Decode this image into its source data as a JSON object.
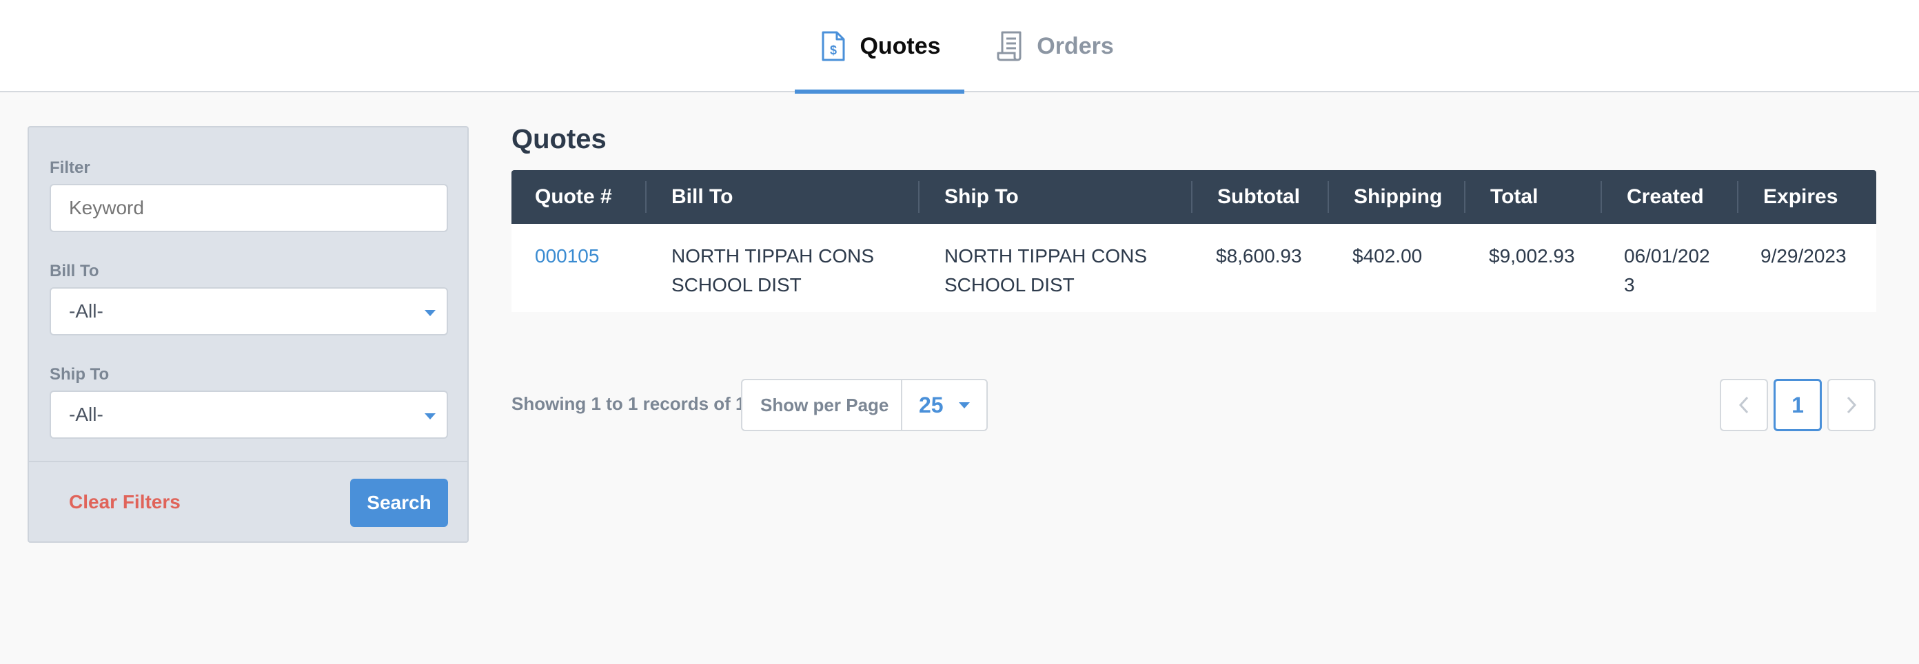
{
  "nav": {
    "tabs": [
      {
        "label": "Quotes",
        "icon": "document-dollar-icon",
        "active": true
      },
      {
        "label": "Orders",
        "icon": "receipt-icon",
        "active": false
      }
    ]
  },
  "filters": {
    "filter_label": "Filter",
    "keyword_placeholder": "Keyword",
    "bill_to_label": "Bill To",
    "bill_to_value": "-All-",
    "ship_to_label": "Ship To",
    "ship_to_value": "-All-",
    "clear_label": "Clear Filters",
    "search_label": "Search"
  },
  "main": {
    "title": "Quotes",
    "columns": [
      "Quote #",
      "Bill To",
      "Ship To",
      "Subtotal",
      "Shipping",
      "Total",
      "Created",
      "Expires"
    ],
    "rows": [
      {
        "quote_no": "000105",
        "bill_to_line1": "NORTH TIPPAH CONS",
        "bill_to_line2": "SCHOOL DIST",
        "ship_to_line1": "NORTH TIPPAH CONS",
        "ship_to_line2": "SCHOOL DIST",
        "subtotal": "$8,600.93",
        "shipping": "$402.00",
        "total": "$9,002.93",
        "created_line1": "06/01/202",
        "created_line2": "3",
        "expires": "9/29/2023"
      }
    ]
  },
  "pagination": {
    "showing": "Showing 1 to 1 records of 1",
    "per_page_label": "Show per Page",
    "per_page_value": "25",
    "current_page": "1"
  },
  "colors": {
    "accent": "#4a90d9",
    "header_bg": "#354455",
    "danger": "#e0645a",
    "panel_bg": "#dde2e9"
  }
}
